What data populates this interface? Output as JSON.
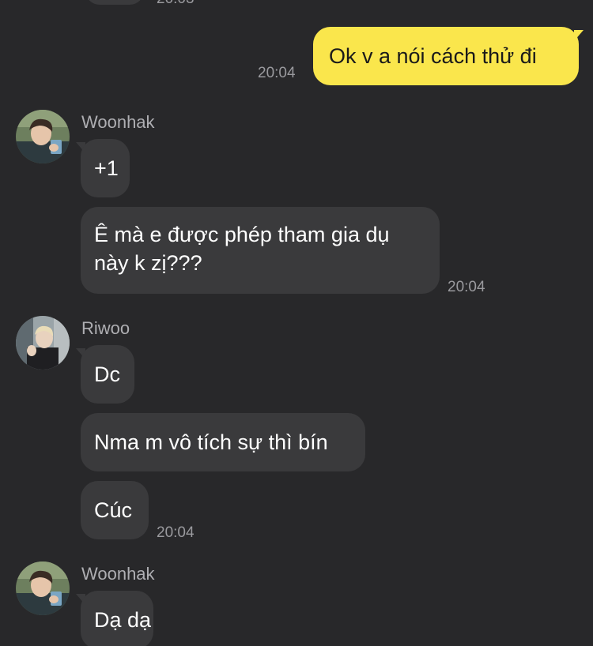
{
  "top_time_fragment": "20:03",
  "messages": {
    "out1": {
      "text": "Ok v a nói cách thử đi",
      "time": "20:04"
    },
    "group1": {
      "sender": "Woonhak",
      "m1": {
        "text": "+1"
      },
      "m2": {
        "text": "Ê mà e được phép tham gia dụ này k zị???",
        "time": "20:04"
      }
    },
    "group2": {
      "sender": "Riwoo",
      "m1": {
        "text": "Dc"
      },
      "m2": {
        "text": "Nma m vô tích sự thì bín"
      },
      "m3": {
        "text": "Cúc",
        "time": "20:04"
      }
    },
    "group3": {
      "sender": "Woonhak",
      "m1": {
        "text": "Dạ dạ"
      }
    }
  },
  "colors": {
    "background": "#28282a",
    "incoming_bubble": "#3a3a3c",
    "outgoing_bubble": "#fae64c"
  }
}
